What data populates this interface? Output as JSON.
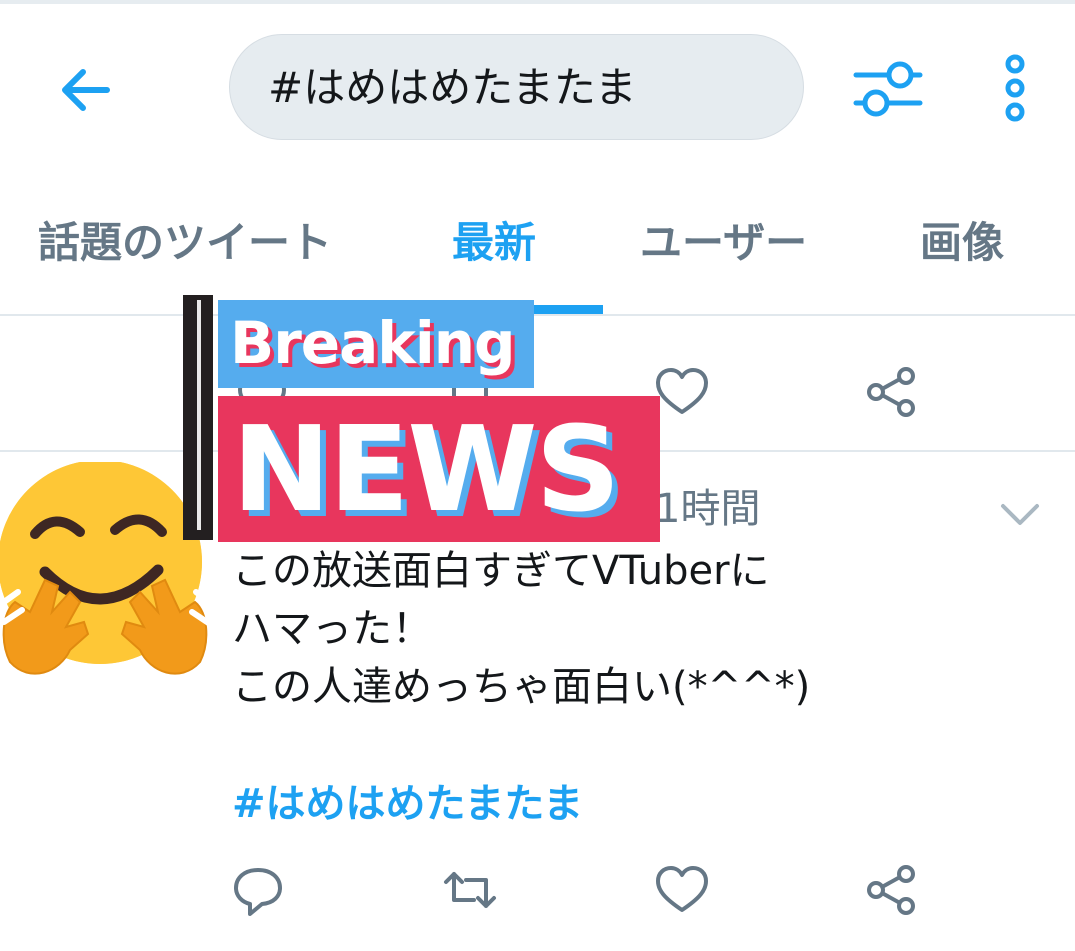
{
  "search": {
    "query": "#はめはめたまたま"
  },
  "tabs": [
    {
      "label": "話題のツイート"
    },
    {
      "label": "最新"
    },
    {
      "label": "ユーザー"
    },
    {
      "label": "画像"
    }
  ],
  "overlay": {
    "breaking": "Breaking",
    "news": "NEWS"
  },
  "tweet": {
    "time": "1時間",
    "lines": [
      "この放送面白すぎてVTuberに",
      "ハマった！",
      "この人達めっちゃ面白い(*^^*)"
    ],
    "hashtag": "#はめはめたまたま"
  },
  "colors": {
    "accent": "#1da1f2",
    "muted": "#657786",
    "news_red": "#e8365d",
    "news_blue": "#55acee"
  },
  "icons": [
    "back-arrow-icon",
    "filter-sliders-icon",
    "more-vertical-icon",
    "reply-icon",
    "retweet-icon",
    "like-heart-icon",
    "share-icon",
    "chevron-down-icon",
    "hugging-face-emoji"
  ]
}
